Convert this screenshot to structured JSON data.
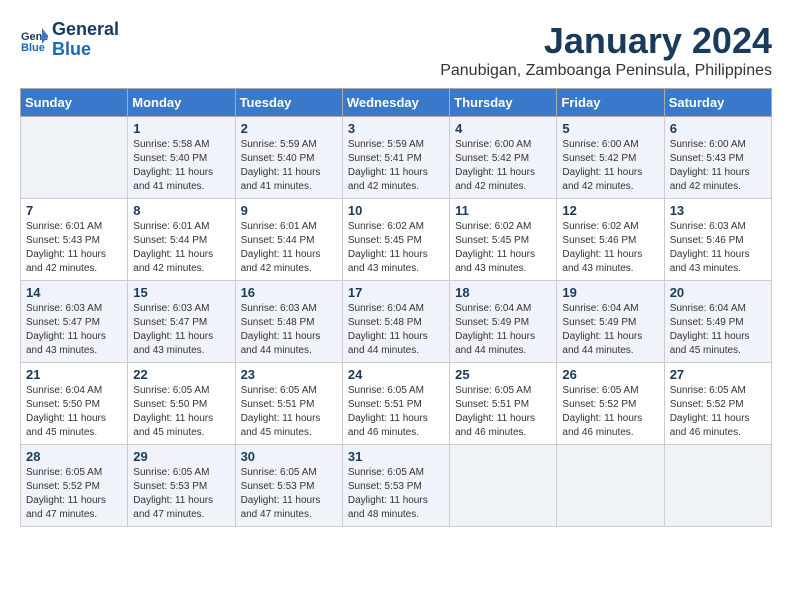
{
  "app": {
    "logo_line1": "General",
    "logo_line2": "Blue"
  },
  "title": "January 2024",
  "location": "Panubigan, Zamboanga Peninsula, Philippines",
  "days_of_week": [
    "Sunday",
    "Monday",
    "Tuesday",
    "Wednesday",
    "Thursday",
    "Friday",
    "Saturday"
  ],
  "weeks": [
    [
      {
        "day": "",
        "info": ""
      },
      {
        "day": "1",
        "info": "Sunrise: 5:58 AM\nSunset: 5:40 PM\nDaylight: 11 hours\nand 41 minutes."
      },
      {
        "day": "2",
        "info": "Sunrise: 5:59 AM\nSunset: 5:40 PM\nDaylight: 11 hours\nand 41 minutes."
      },
      {
        "day": "3",
        "info": "Sunrise: 5:59 AM\nSunset: 5:41 PM\nDaylight: 11 hours\nand 42 minutes."
      },
      {
        "day": "4",
        "info": "Sunrise: 6:00 AM\nSunset: 5:42 PM\nDaylight: 11 hours\nand 42 minutes."
      },
      {
        "day": "5",
        "info": "Sunrise: 6:00 AM\nSunset: 5:42 PM\nDaylight: 11 hours\nand 42 minutes."
      },
      {
        "day": "6",
        "info": "Sunrise: 6:00 AM\nSunset: 5:43 PM\nDaylight: 11 hours\nand 42 minutes."
      }
    ],
    [
      {
        "day": "7",
        "info": "Sunrise: 6:01 AM\nSunset: 5:43 PM\nDaylight: 11 hours\nand 42 minutes."
      },
      {
        "day": "8",
        "info": "Sunrise: 6:01 AM\nSunset: 5:44 PM\nDaylight: 11 hours\nand 42 minutes."
      },
      {
        "day": "9",
        "info": "Sunrise: 6:01 AM\nSunset: 5:44 PM\nDaylight: 11 hours\nand 42 minutes."
      },
      {
        "day": "10",
        "info": "Sunrise: 6:02 AM\nSunset: 5:45 PM\nDaylight: 11 hours\nand 43 minutes."
      },
      {
        "day": "11",
        "info": "Sunrise: 6:02 AM\nSunset: 5:45 PM\nDaylight: 11 hours\nand 43 minutes."
      },
      {
        "day": "12",
        "info": "Sunrise: 6:02 AM\nSunset: 5:46 PM\nDaylight: 11 hours\nand 43 minutes."
      },
      {
        "day": "13",
        "info": "Sunrise: 6:03 AM\nSunset: 5:46 PM\nDaylight: 11 hours\nand 43 minutes."
      }
    ],
    [
      {
        "day": "14",
        "info": "Sunrise: 6:03 AM\nSunset: 5:47 PM\nDaylight: 11 hours\nand 43 minutes."
      },
      {
        "day": "15",
        "info": "Sunrise: 6:03 AM\nSunset: 5:47 PM\nDaylight: 11 hours\nand 43 minutes."
      },
      {
        "day": "16",
        "info": "Sunrise: 6:03 AM\nSunset: 5:48 PM\nDaylight: 11 hours\nand 44 minutes."
      },
      {
        "day": "17",
        "info": "Sunrise: 6:04 AM\nSunset: 5:48 PM\nDaylight: 11 hours\nand 44 minutes."
      },
      {
        "day": "18",
        "info": "Sunrise: 6:04 AM\nSunset: 5:49 PM\nDaylight: 11 hours\nand 44 minutes."
      },
      {
        "day": "19",
        "info": "Sunrise: 6:04 AM\nSunset: 5:49 PM\nDaylight: 11 hours\nand 44 minutes."
      },
      {
        "day": "20",
        "info": "Sunrise: 6:04 AM\nSunset: 5:49 PM\nDaylight: 11 hours\nand 45 minutes."
      }
    ],
    [
      {
        "day": "21",
        "info": "Sunrise: 6:04 AM\nSunset: 5:50 PM\nDaylight: 11 hours\nand 45 minutes."
      },
      {
        "day": "22",
        "info": "Sunrise: 6:05 AM\nSunset: 5:50 PM\nDaylight: 11 hours\nand 45 minutes."
      },
      {
        "day": "23",
        "info": "Sunrise: 6:05 AM\nSunset: 5:51 PM\nDaylight: 11 hours\nand 45 minutes."
      },
      {
        "day": "24",
        "info": "Sunrise: 6:05 AM\nSunset: 5:51 PM\nDaylight: 11 hours\nand 46 minutes."
      },
      {
        "day": "25",
        "info": "Sunrise: 6:05 AM\nSunset: 5:51 PM\nDaylight: 11 hours\nand 46 minutes."
      },
      {
        "day": "26",
        "info": "Sunrise: 6:05 AM\nSunset: 5:52 PM\nDaylight: 11 hours\nand 46 minutes."
      },
      {
        "day": "27",
        "info": "Sunrise: 6:05 AM\nSunset: 5:52 PM\nDaylight: 11 hours\nand 46 minutes."
      }
    ],
    [
      {
        "day": "28",
        "info": "Sunrise: 6:05 AM\nSunset: 5:52 PM\nDaylight: 11 hours\nand 47 minutes."
      },
      {
        "day": "29",
        "info": "Sunrise: 6:05 AM\nSunset: 5:53 PM\nDaylight: 11 hours\nand 47 minutes."
      },
      {
        "day": "30",
        "info": "Sunrise: 6:05 AM\nSunset: 5:53 PM\nDaylight: 11 hours\nand 47 minutes."
      },
      {
        "day": "31",
        "info": "Sunrise: 6:05 AM\nSunset: 5:53 PM\nDaylight: 11 hours\nand 48 minutes."
      },
      {
        "day": "",
        "info": ""
      },
      {
        "day": "",
        "info": ""
      },
      {
        "day": "",
        "info": ""
      }
    ]
  ]
}
